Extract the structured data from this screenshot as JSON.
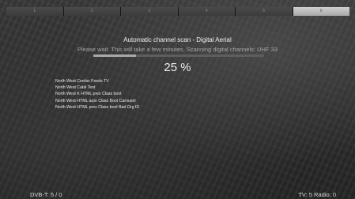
{
  "wizard": {
    "steps": [
      {
        "label": "1",
        "active": false
      },
      {
        "label": "2",
        "active": false
      },
      {
        "label": "3",
        "active": false
      },
      {
        "label": "4",
        "active": false
      },
      {
        "label": "5",
        "active": false
      },
      {
        "label": "6",
        "active": true
      }
    ]
  },
  "scan": {
    "title": "Automatic channel scan - Digital Aerial",
    "status": "Please wait. This will take a few minutes. Scanning digital channels: UHF 33",
    "progress_percent": 25,
    "percent_label": "25 %"
  },
  "found_services": [
    "North West Ceefax Feeds TV",
    "North West Catal Test",
    "North West K HTML pres Class boot",
    "North West HTML auto Class Boot Carousel",
    "North West HTML pres Class boot Bad Org ID"
  ],
  "footer": {
    "dvbt_count": "DVB-T: 5 / 0",
    "tv_radio_count": "TV: 5 Radio: 0"
  },
  "colors": {
    "progress_fill": "#a8a8a8",
    "progress_track": "#5e5e5e",
    "active_step": "#cfcfcf"
  }
}
